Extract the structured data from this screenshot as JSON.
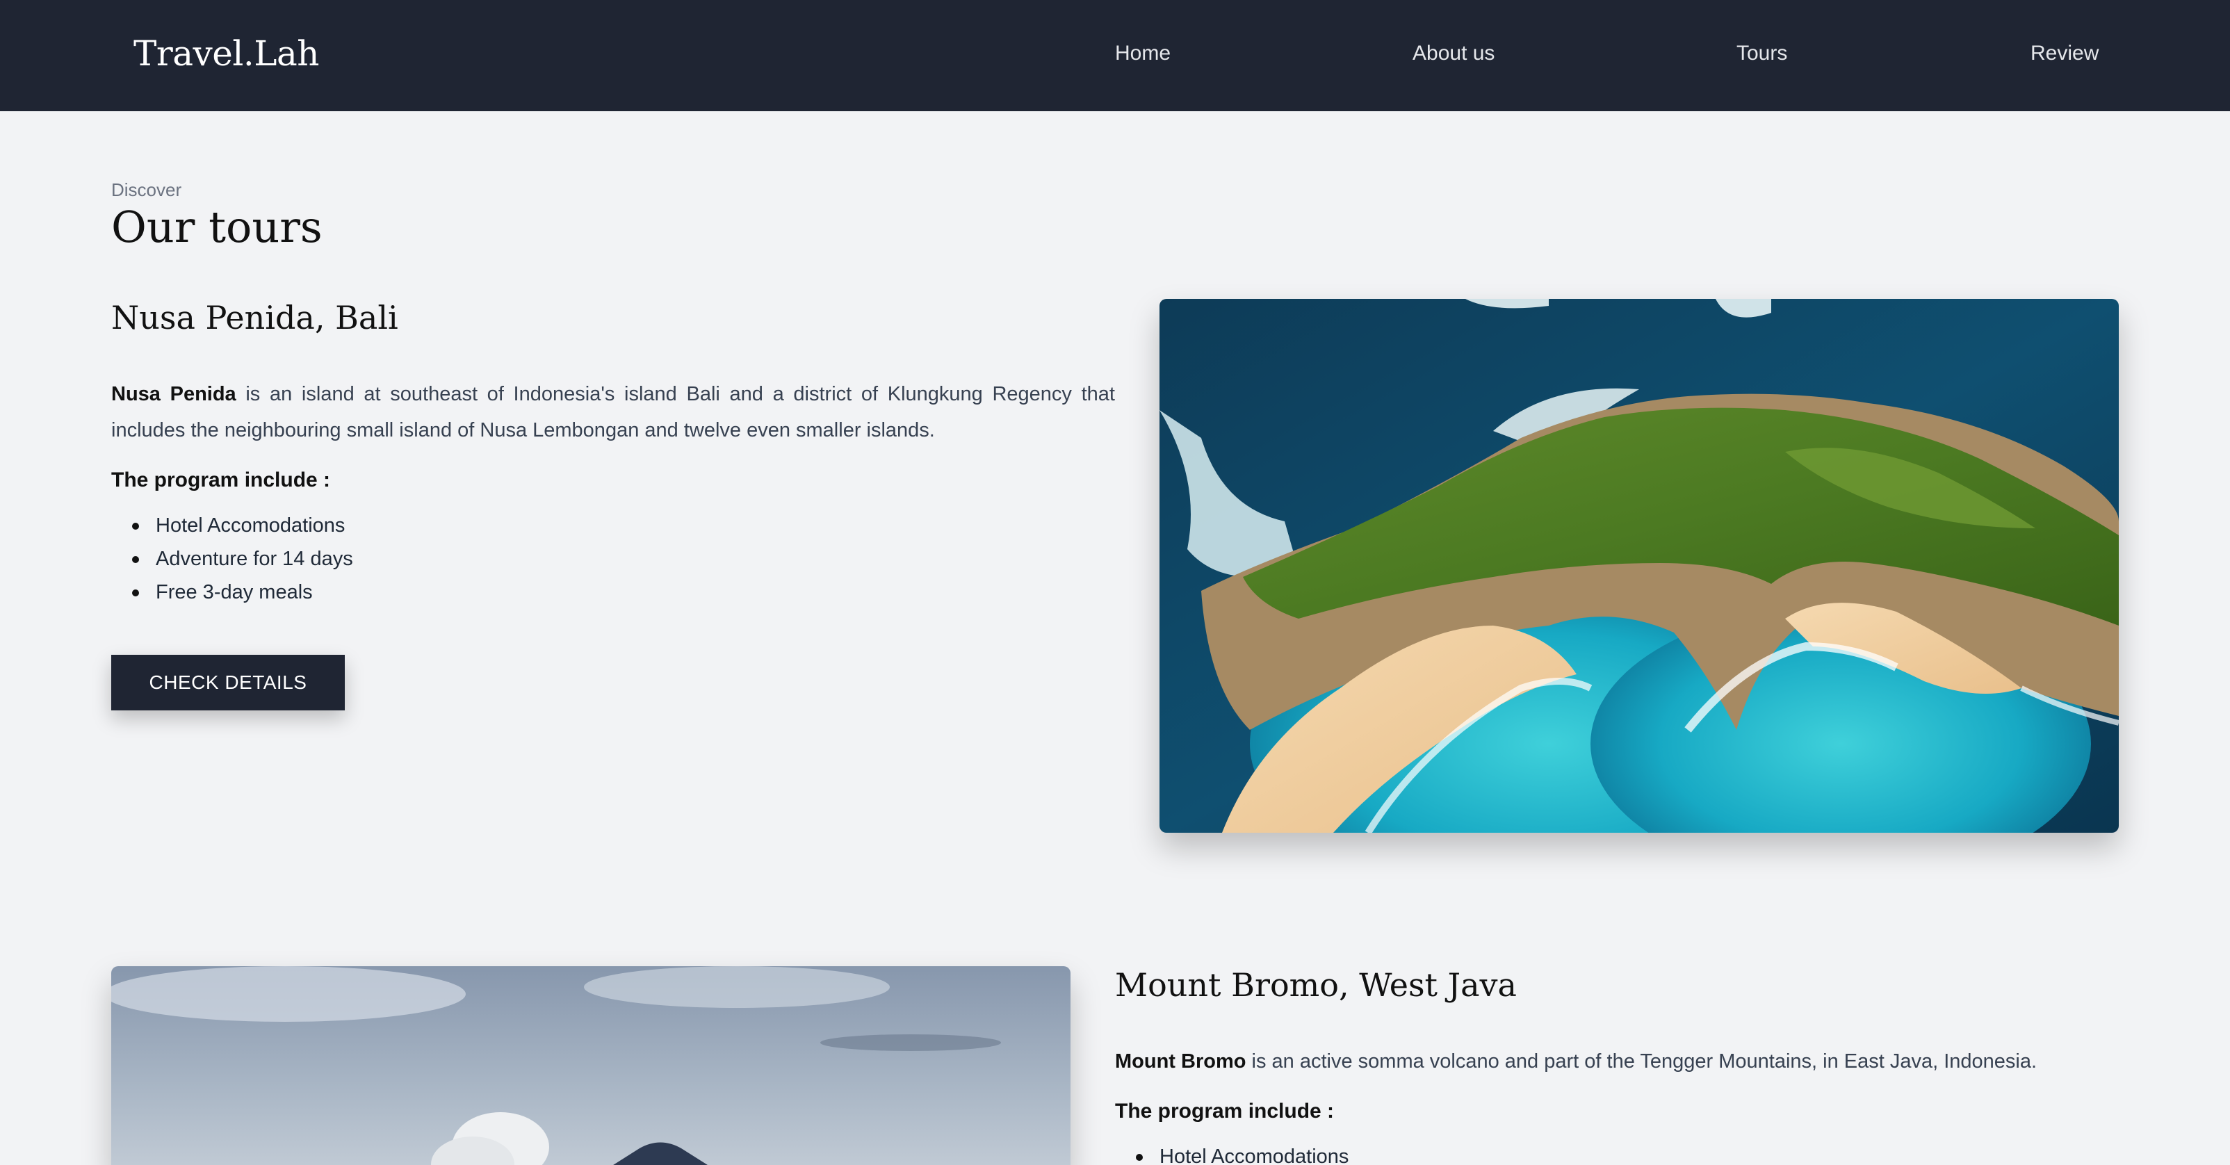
{
  "header": {
    "brand": "Travel.Lah",
    "nav": [
      "Home",
      "About us",
      "Tours",
      "Review"
    ]
  },
  "section": {
    "eyebrow": "Discover",
    "title": "Our tours"
  },
  "tours": [
    {
      "title": "Nusa Penida, Bali",
      "highlight": "Nusa Penida",
      "description": " is an island at southeast of Indonesia's island Bali and a district of Klungkung Regency that includes the neighbouring small island of Nusa Lembongan and twelve even smaller islands.",
      "program_label": "The program include :",
      "program": [
        "Hotel Accomodations",
        "Adventure for 14 days",
        "Free 3-day meals"
      ],
      "cta": "CHECK DETAILS"
    },
    {
      "title": "Mount Bromo, West Java",
      "highlight": "Mount Bromo",
      "description": " is an active somma volcano and part of the Tengger Mountains, in East Java, Indonesia.",
      "program_label": "The program include :",
      "program": [
        "Hotel Accomodations"
      ]
    }
  ],
  "colors": {
    "navbar": "#1f2533",
    "page_background": "#f2f3f5",
    "button": "#1f2533"
  }
}
